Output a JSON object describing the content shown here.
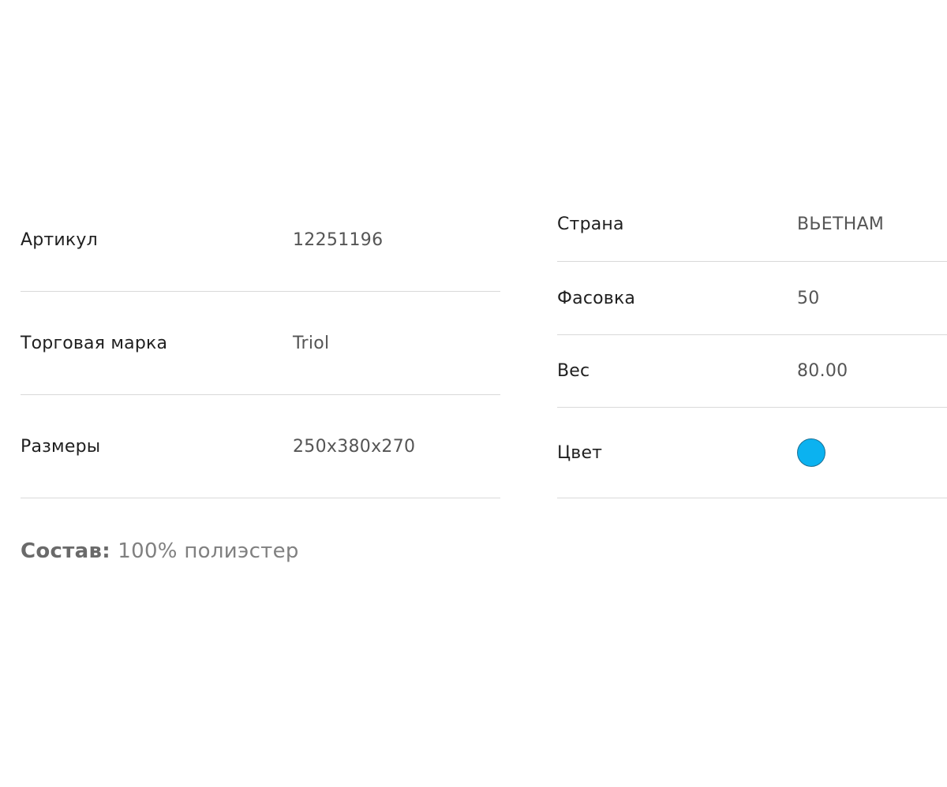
{
  "specs_left": [
    {
      "label": "Артикул",
      "value": "12251196"
    },
    {
      "label": "Торговая марка",
      "value": "Triol"
    },
    {
      "label": "Размеры",
      "value": "250x380x270"
    }
  ],
  "specs_right": [
    {
      "label": "Страна",
      "value": "ВЬЕТНАМ"
    },
    {
      "label": "Фасовка",
      "value": "50"
    },
    {
      "label": "Вес",
      "value": "80.00"
    },
    {
      "label": "Цвет",
      "color": "#0bb2f0"
    }
  ],
  "composition": {
    "label": "Состав:",
    "value": "100% полиэстер"
  }
}
